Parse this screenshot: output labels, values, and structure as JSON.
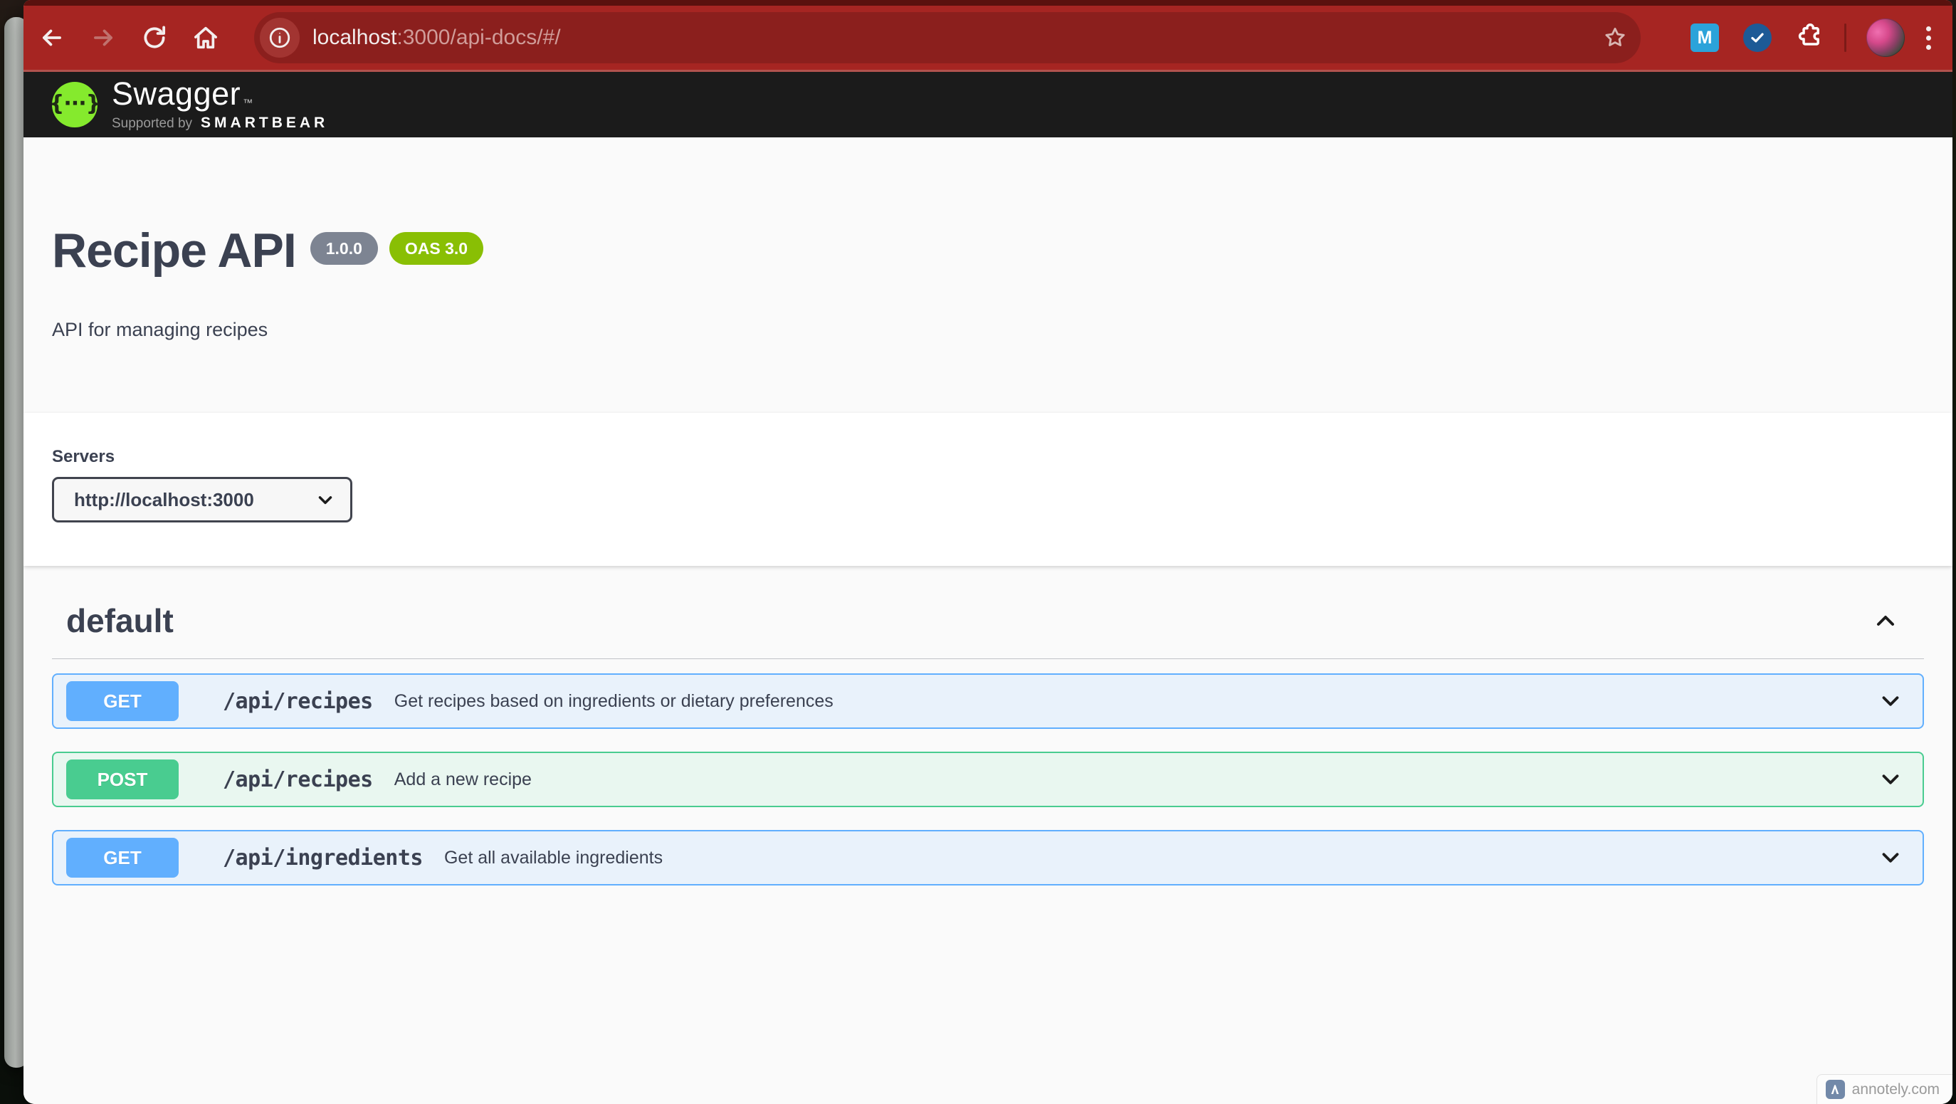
{
  "chrome": {
    "url_host": "localhost",
    "url_path": ":3000/api-docs/#/",
    "extension_m_label": "M"
  },
  "swagger_header": {
    "logo_glyph": "{···}",
    "brand": "Swagger",
    "brand_tm": "™",
    "supported_by": "Supported by",
    "sponsor": "SMARTBEAR"
  },
  "api": {
    "title": "Recipe API",
    "version": "1.0.0",
    "spec": "OAS 3.0",
    "description": "API for managing recipes"
  },
  "servers": {
    "label": "Servers",
    "selected": "http://localhost:3000"
  },
  "tag": {
    "name": "default"
  },
  "operations": [
    {
      "method": "GET",
      "path": "/api/recipes",
      "summary": "Get recipes based on ingredients or dietary preferences"
    },
    {
      "method": "POST",
      "path": "/api/recipes",
      "summary": "Add a new recipe"
    },
    {
      "method": "GET",
      "path": "/api/ingredients",
      "summary": "Get all available ingredients"
    }
  ],
  "watermark": {
    "text": "annotely.com"
  },
  "colors": {
    "get_blue": "#61affe",
    "post_green": "#49cc90",
    "oas_green": "#89bf04",
    "version_gray": "#7d8492",
    "brand_green": "#85ea2d",
    "toolbar_red": "#a62522",
    "omnibox_red": "#8b1f1d",
    "topbar_black": "#1b1b1b",
    "text_slate": "#3b4151"
  }
}
